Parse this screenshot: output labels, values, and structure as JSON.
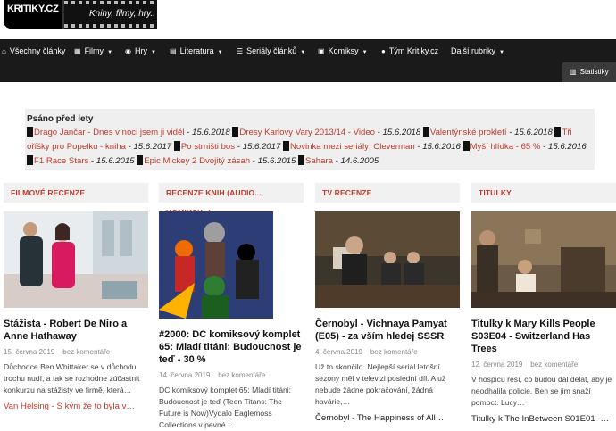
{
  "logo": {
    "brand": "KRITIKY.CZ",
    "tagline": "Knihy, filmy, hry.."
  },
  "nav": [
    {
      "label": "Všechny články",
      "icon": "home-icon",
      "caret": false
    },
    {
      "label": "Filmy",
      "icon": "film-icon",
      "caret": true
    },
    {
      "label": "Hry",
      "icon": "gamepad-icon",
      "caret": true
    },
    {
      "label": "Literatura",
      "icon": "book-icon",
      "caret": true
    },
    {
      "label": "Seriály článků",
      "icon": "list-icon",
      "caret": true
    },
    {
      "label": "Komiksy",
      "icon": "image-icon",
      "caret": true
    },
    {
      "label": "Tým Kritiky.cz",
      "icon": "user-icon",
      "caret": false
    },
    {
      "label": "Další rubriky",
      "icon": "",
      "caret": true
    }
  ],
  "stat": {
    "label": "Statistiky"
  },
  "recent": {
    "title": "Psáno před lety",
    "items": [
      {
        "title": "Drago Jančar - Dnes v noci jsem ji viděl",
        "date": "15.6.2018"
      },
      {
        "title": "Dresy Karlovy Vary 2013/14 - Video",
        "date": "15.6.2018"
      },
      {
        "title": "Valentýnské prokletí",
        "date": "15.6.2018"
      },
      {
        "title": "Tři oříšky pro Popelku - kniha",
        "date": "15.6.2017"
      },
      {
        "title": "Po strništi bos",
        "date": "15.6.2017"
      },
      {
        "title": "Novinka mezi seriály: Cleverman",
        "date": "15.6.2016"
      },
      {
        "title": "Myší hlídka - 65 %",
        "date": "15.6.2016"
      },
      {
        "title": "F1 Race Stars",
        "date": "15.6.2015"
      },
      {
        "title": "Epic Mickey 2 Dvojitý zásah",
        "date": "15.6.2015"
      },
      {
        "title": "Sahara",
        "date": "14.6.2005"
      }
    ]
  },
  "columns": [
    {
      "header": "FILMOVÉ RECENZE",
      "title": "Stážista - Robert De Niro a Anne Hathaway",
      "date": "15. června 2019",
      "comments": "bez komentáře",
      "excerpt": "Důchodce Ben Whittaker se v důchodu trochu nudí, a tak se rozhodne zúčastnit konkurzu na stážisty ve firmě, která…",
      "next": "Van Helsing - S kým že to byla v…"
    },
    {
      "header": "RECENZE KNIH (AUDIO... KOMIKSY...)",
      "title": "#2000: DC komiksový komplet 65: Mladí titáni: Budoucnost je teď - 30 %",
      "date": "14. června 2019",
      "comments": "bez komentáře",
      "excerpt": "DC komiksový komplet 65: Mladí titáni: Budoucnost je teď (Teen Titans: The Future is Now)Vydalo Eaglemoss Collections v pevné…",
      "next": ""
    },
    {
      "header": "TV RECENZE",
      "title": "Černobyl - Vichnaya Pamyat (E05) - za vším hledej SSSR",
      "date": "4. června 2019",
      "comments": "bez komentáře",
      "excerpt": "Už to skončilo. Nejlepší seriál letošní sezony měl v televizi poslední díl. A už nebude žádné pokračování, žádná havárie,…",
      "next": "Černobyl - The Happiness of All…"
    },
    {
      "header": "TITULKY",
      "title": "Titulky k Mary Kills People S03E04 - Switzerland Has Trees",
      "date": "12. června 2019",
      "comments": "bez komentáře",
      "excerpt": "V hospicu řeší, co budou dál dělat, aby je neodhalila policie. Ben se jim snaží pomoct. Lucy…",
      "next": "Titulky k The InBetween S01E01 -…"
    }
  ]
}
